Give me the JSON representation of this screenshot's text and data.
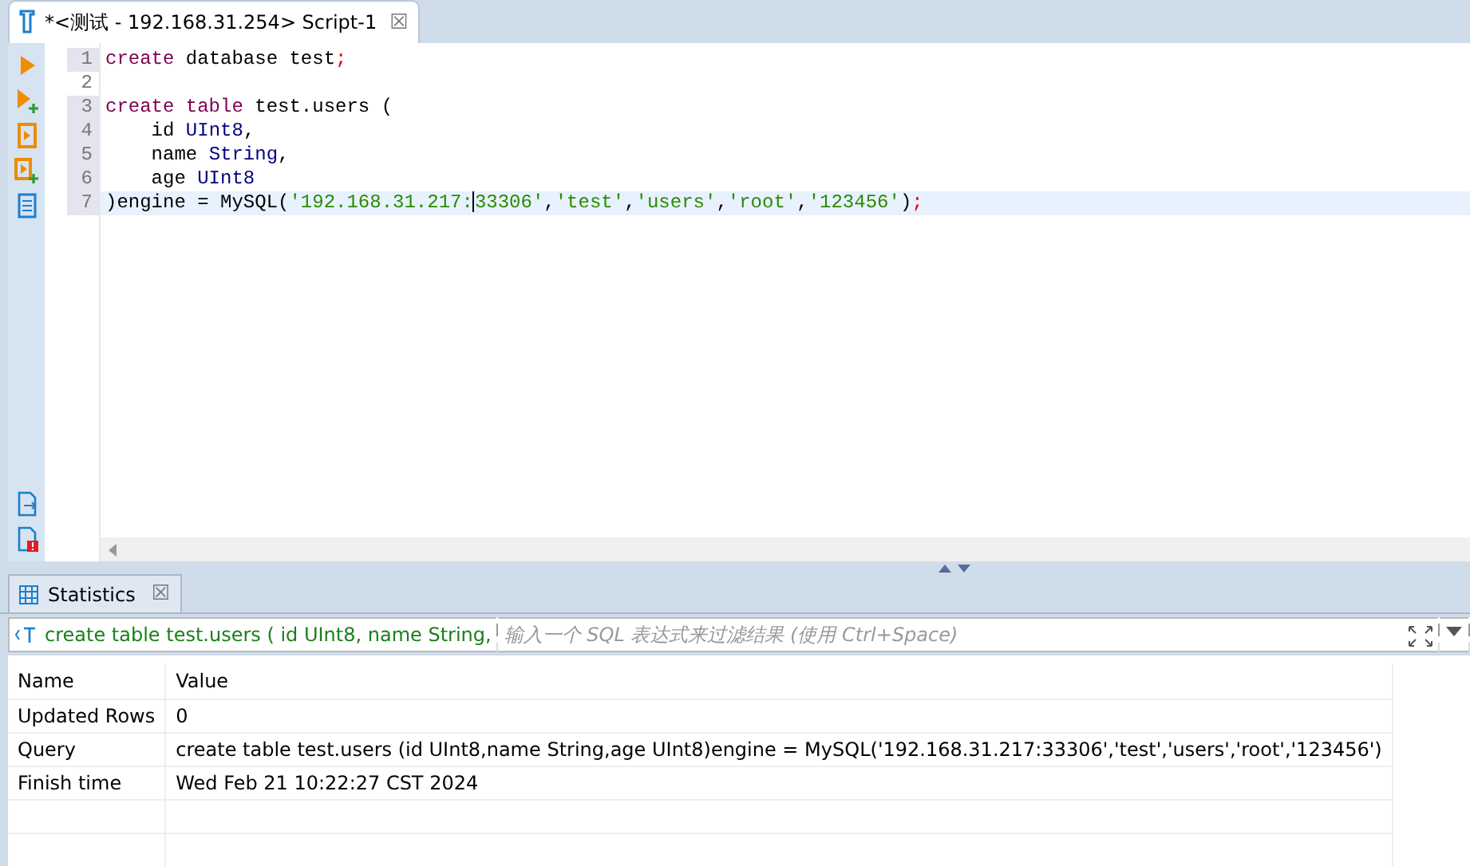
{
  "editor_tab": {
    "title": "*<测试 - 192.168.31.254> Script-1",
    "close": "☒",
    "selected": true
  },
  "toolbar": [
    {
      "kind": "run"
    },
    {
      "kind": "run-add"
    },
    {
      "kind": "script"
    },
    {
      "kind": "script-add"
    },
    {
      "kind": "plan"
    }
  ],
  "toolbar_bottom": [
    {
      "kind": "export"
    },
    {
      "kind": "error"
    }
  ],
  "code_lines": [
    {
      "number": "1",
      "marked": true,
      "selected": false,
      "tokens": [
        {
          "kind": "keyword",
          "text": "create"
        },
        {
          "kind": "plain",
          "text": " database test"
        },
        {
          "kind": "punct",
          "text": ";"
        }
      ]
    },
    {
      "number": "2",
      "marked": false,
      "selected": false
    },
    {
      "number": "3",
      "marked": true,
      "selected": false,
      "tokens": [
        {
          "kind": "keyword",
          "text": "create table"
        },
        {
          "kind": "plain",
          "text": " test.users ("
        }
      ]
    },
    {
      "number": "4",
      "marked": true,
      "selected": false,
      "tokens": [
        {
          "kind": "plain",
          "text": "    id "
        },
        {
          "kind": "type",
          "text": "UInt8"
        },
        {
          "kind": "plain",
          "text": ","
        }
      ]
    },
    {
      "number": "5",
      "marked": true,
      "selected": false,
      "tokens": [
        {
          "kind": "plain",
          "text": "    name "
        },
        {
          "kind": "type",
          "text": "String"
        },
        {
          "kind": "plain",
          "text": ","
        }
      ]
    },
    {
      "number": "6",
      "marked": true,
      "selected": false,
      "tokens": [
        {
          "kind": "plain",
          "text": "    age "
        },
        {
          "kind": "type",
          "text": "UInt8"
        }
      ]
    },
    {
      "number": "7",
      "marked": true,
      "selected": true,
      "tokens": [
        {
          "kind": "plain",
          "text": ")engine = MySQL("
        },
        {
          "kind": "string",
          "text": "'192.168.31.217:"
        },
        {
          "kind": "caret"
        },
        {
          "kind": "string",
          "text": "33306'"
        },
        {
          "kind": "plain",
          "text": ","
        },
        {
          "kind": "string",
          "text": "'test'"
        },
        {
          "kind": "plain",
          "text": ","
        },
        {
          "kind": "string",
          "text": "'users'"
        },
        {
          "kind": "plain",
          "text": ","
        },
        {
          "kind": "string",
          "text": "'root'"
        },
        {
          "kind": "plain",
          "text": ","
        },
        {
          "kind": "string",
          "text": "'123456'"
        },
        {
          "kind": "plain",
          "text": ")"
        },
        {
          "kind": "punct",
          "text": ";"
        }
      ]
    }
  ],
  "results_tab": {
    "title": "Statistics",
    "close": "☒",
    "selected": true
  },
  "filter": {
    "query": "create table test.users ( id UInt8, name String,",
    "placeholder": "输入一个 SQL 表达式来过滤结果 (使用 Ctrl+Space)"
  },
  "table": {
    "columns": [
      "Name",
      "Value"
    ],
    "rows": [
      [
        "Updated Rows",
        "0"
      ],
      [
        "Query",
        "create table test.users (id UInt8,name String,age UInt8)engine = MySQL('192.168.31.217:33306','test','users','root','123456')"
      ],
      [
        "Finish time",
        "Wed Feb 21 10:22:27 CST 2024"
      ]
    ]
  }
}
